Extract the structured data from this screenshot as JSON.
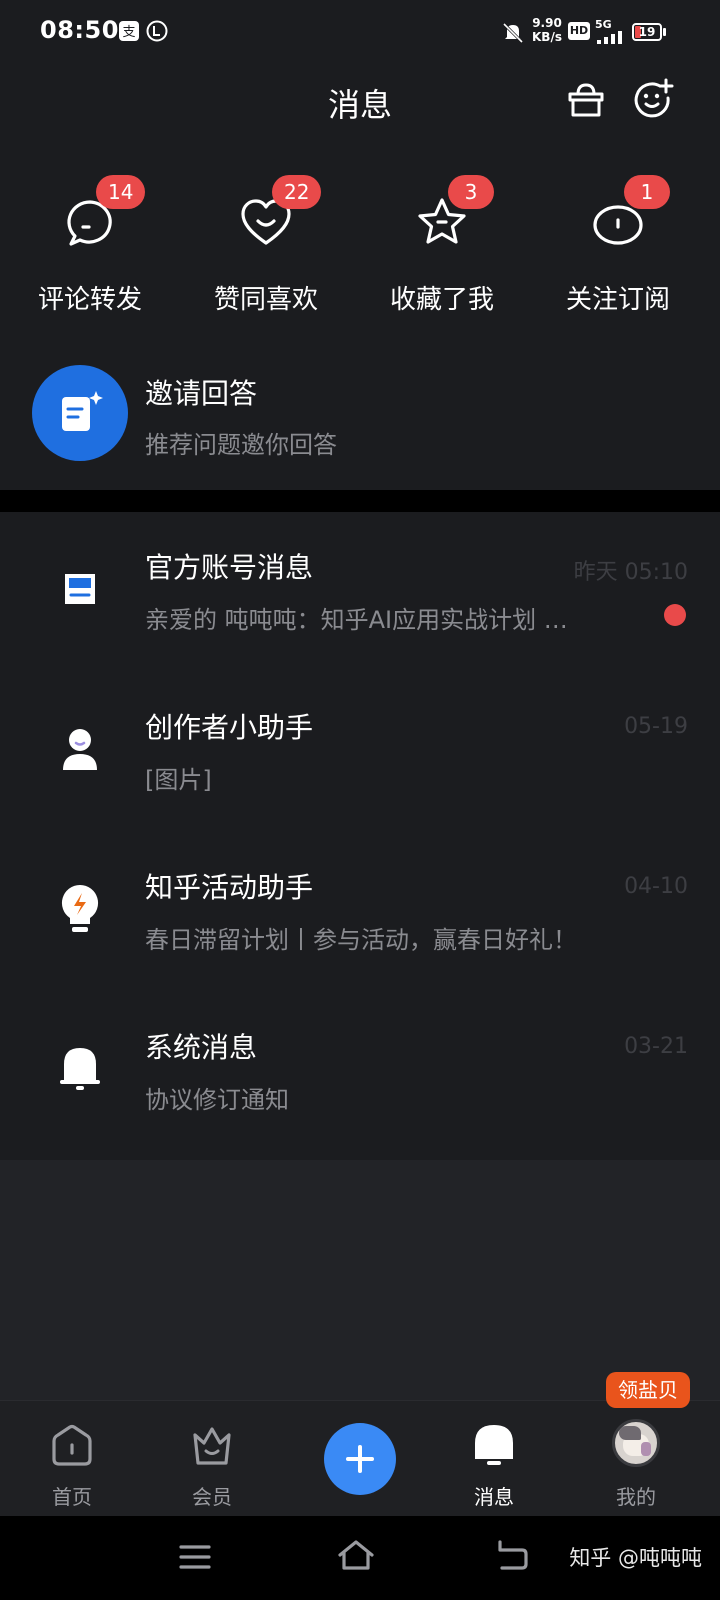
{
  "status_bar": {
    "time": "08:50",
    "net_speed_top": "9.90",
    "net_speed_bottom": "KB/s",
    "hd": "HD",
    "network": "5G",
    "battery": "19"
  },
  "header": {
    "title": "消息"
  },
  "categories": [
    {
      "label": "评论转发",
      "badge": "14",
      "icon": "comment-icon"
    },
    {
      "label": "赞同喜欢",
      "badge": "22",
      "icon": "heart-icon"
    },
    {
      "label": "收藏了我",
      "badge": "3",
      "icon": "star-icon"
    },
    {
      "label": "关注订阅",
      "badge": "1",
      "icon": "follow-icon"
    }
  ],
  "invite": {
    "title": "邀请回答",
    "subtitle": "推荐问题邀你回答"
  },
  "messages": [
    {
      "title": "官方账号消息",
      "preview": "亲爱的 吨吨吨：知乎AI应用实战计划 …",
      "time": "昨天 05:10",
      "unread": true,
      "color": "#1f6fe0",
      "icon": "inbox-icon"
    },
    {
      "title": "创作者小助手",
      "preview": "[图片]",
      "time": "05-19",
      "unread": false,
      "color": "#9c8fe0",
      "icon": "person-icon"
    },
    {
      "title": "知乎活动助手",
      "preview": "春日滞留计划丨参与活动，赢春日好礼！",
      "time": "04-10",
      "unread": false,
      "color": "#e96a14",
      "icon": "bulb-icon"
    },
    {
      "title": "系统消息",
      "preview": "协议修订通知",
      "time": "03-21",
      "unread": false,
      "color": "#6f93cf",
      "icon": "bell-icon"
    }
  ],
  "bottom_nav": {
    "home": "首页",
    "vip": "会员",
    "messages": "消息",
    "mine": "我的",
    "promo": "领盐贝"
  },
  "watermark": "知乎 @吨吨吨"
}
